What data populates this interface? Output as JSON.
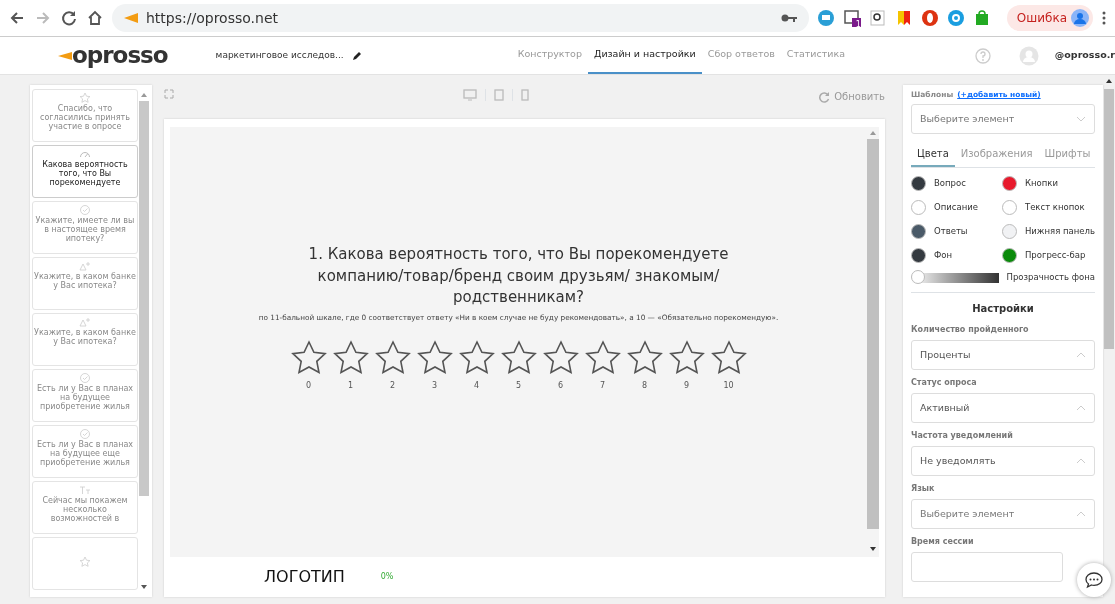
{
  "browser": {
    "url": "https://oprosso.net",
    "profile_button": "Ошибка",
    "extension_badge": "1"
  },
  "header": {
    "logo": "oprosso",
    "survey_title": "маркетинговое исследов...",
    "nav": [
      {
        "label": "Конструктор",
        "selected": false
      },
      {
        "label": "Дизайн и настройки",
        "selected": true
      },
      {
        "label": "Сбор ответов",
        "selected": false
      },
      {
        "label": "Статистика",
        "selected": false
      }
    ],
    "user": "@oprosso.r"
  },
  "sidebar": {
    "cards": [
      {
        "kind": "star",
        "text": "Спасибо, что согласились принять участие в опросе",
        "selected": false
      },
      {
        "kind": "gauge",
        "text": "Какова вероятность того, что Вы порекомендуете",
        "selected": true
      },
      {
        "kind": "check",
        "text": "Укажите, имеете ли вы в настоящее время ипотеку?",
        "selected": false
      },
      {
        "kind": "person",
        "text": "Укажите, в каком банке у Вас ипотека?",
        "selected": false
      },
      {
        "kind": "person",
        "text": "Укажите, в каком банке у Вас ипотека?",
        "selected": false
      },
      {
        "kind": "check",
        "text": "Есть ли у Вас в планах на будущее приобретение жилья",
        "selected": false
      },
      {
        "kind": "check",
        "text": "Есть ли у Вас в планах на будущее еще приобретение жилья",
        "selected": false
      },
      {
        "kind": "text",
        "text": "Сейчас мы покажем несколько возможностей в",
        "selected": false
      },
      {
        "kind": "star",
        "selected": false
      }
    ]
  },
  "toolbar": {
    "refresh": "Обновить"
  },
  "question": {
    "title": "1. Какова вероятность того, что Вы порекомендуете компанию/товар/бренд своим друзьям/ знакомым/ родственникам?",
    "hint": "по 11-бальной шкале, где 0 соответствует ответу «Ни в коем случае не буду рекомендовать»,  а 10 — «Обязательно порекомендую».",
    "scale": [
      "0",
      "1",
      "2",
      "3",
      "4",
      "5",
      "6",
      "7",
      "8",
      "9",
      "10"
    ]
  },
  "footer": {
    "logo": "ЛОГОТИП",
    "progress": "0%"
  },
  "settings": {
    "templates_label": "Шаблоны",
    "add_link": "(+добавить новый)",
    "template_placeholder": "Выберите элемент",
    "tabs": [
      {
        "label": "Цвета",
        "selected": true
      },
      {
        "label": "Изображения",
        "selected": false
      },
      {
        "label": "Шрифты",
        "selected": false
      }
    ],
    "colors": [
      {
        "label": "Вопрос",
        "color": "#343a40"
      },
      {
        "label": "Кнопки",
        "color": "#e8192c"
      },
      {
        "label": "Описание",
        "color": "#ffffff"
      },
      {
        "label": "Текст кнопок",
        "color": "#ffffff"
      },
      {
        "label": "Ответы",
        "color": "#4a5a68"
      },
      {
        "label": "Нижняя панель",
        "color": "#f1f2f4"
      },
      {
        "label": "Фон",
        "color": "#343a40"
      },
      {
        "label": "Прогресс-бар",
        "color": "#0a8a0a"
      }
    ],
    "opacity": {
      "label": "Прозрачность фона",
      "level": 0
    },
    "section_title": "Настройки",
    "fields": [
      {
        "label": "Количество пройденного",
        "value": "Проценты"
      },
      {
        "label": "Статус опроса",
        "value": "Активный"
      },
      {
        "label": "Частота уведомлений",
        "value": "Не уведомлять"
      },
      {
        "label": "Язык",
        "placeholder": "Выберите элемент"
      },
      {
        "label": "Время сессии"
      }
    ]
  }
}
